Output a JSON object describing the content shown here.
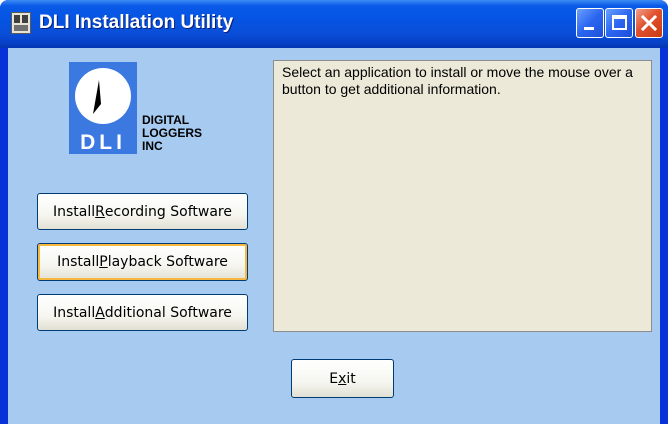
{
  "window": {
    "title": "DLI Installation Utility",
    "colors": {
      "titlebar": "#0554e3",
      "client_bg": "#a6caf0",
      "info_bg": "#ece9d8",
      "close_button": "#e0502c"
    }
  },
  "logo": {
    "letters": "DLI",
    "line1": "DIGITAL",
    "line2": "LOGGERS",
    "line3": "INC"
  },
  "buttons": {
    "recording": {
      "before": "Install ",
      "accel": "R",
      "after": "ecording Software"
    },
    "playback": {
      "before": "Install ",
      "accel": "P",
      "after": "layback Software"
    },
    "additional": {
      "before": "Install ",
      "accel": "A",
      "after": "dditional Software"
    },
    "exit": {
      "before": "E",
      "accel": "x",
      "after": "it"
    }
  },
  "info": {
    "text": "Select an application to install or move the mouse over a button to get additional information."
  },
  "icons": {
    "title_icon": "installer-app-icon",
    "minimize": "minimize-icon",
    "maximize": "maximize-icon",
    "close": "close-icon"
  }
}
